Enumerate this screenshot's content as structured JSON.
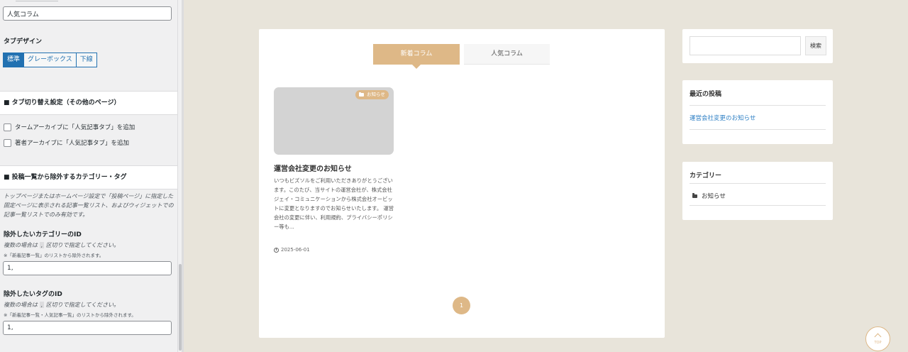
{
  "customizer": {
    "title_input_value": "人気コラム",
    "tab_design_label": "タブデザイン",
    "tab_design_options": [
      "標準",
      "グレーボックス",
      "下線"
    ],
    "tab_design_selected": "標準",
    "tab_switch_section_title": "■ タブ切り替え設定（その他のページ）",
    "checkboxes": [
      "タームアーカイブに「人気記事タブ」を追加",
      "著者アーカイブに「人気記事タブ」を追加"
    ],
    "exclude_section_title": "■ 投稿一覧から除外するカテゴリー・タグ",
    "exclude_description": "トップページまたはホームページ設定で「投稿ページ」に指定した固定ページに表示される記事一覧リスト、およびウィジェットでの記事一覧リストでのみ有効です。",
    "exclude_cat": {
      "label": "除外したいカテゴリーのID",
      "help_pre": "複数の場合は",
      "help_code": ",",
      "help_post": "区切りで指定してください。",
      "note": "※「新着記事一覧」のリストから除外されます。",
      "value": "1,"
    },
    "exclude_tag": {
      "label": "除外したいタグのID",
      "help_pre": "複数の場合は",
      "help_code": ",",
      "help_post": "区切りで指定してください。",
      "note": "※「新着記事一覧・人気記事一覧」のリストから除外されます。",
      "value": "1,"
    }
  },
  "main": {
    "tabs": [
      "新着コラム",
      "人気コラム"
    ],
    "active_tab": "新着コラム",
    "post": {
      "category": "お知らせ",
      "title": "運営会社変更のお知らせ",
      "excerpt": "いつもビズソルをご利用いただきありがとうございます。このたび、当サイトの運営会社が、株式会社ジェイ・コミュニケーションから株式会社オービットに変更となりますのでお知らせいたします。 運営会社の変更に伴い、利用規約、プライバシーポリシー等も...",
      "date": "2025-06-01"
    },
    "pagination": [
      "1"
    ]
  },
  "sidebar": {
    "search_button": "検索",
    "search_value": "",
    "recent_title": "最近の投稿",
    "recent_posts": [
      "運営会社変更のお知らせ"
    ],
    "category_title": "カテゴリー",
    "categories": [
      "お知らせ"
    ]
  },
  "back_to_top_label": "TOP",
  "colors": {
    "accent": "#deb887",
    "admin_blue": "#2271b1",
    "link": "#2f80c5",
    "page_bg": "#e8e4da"
  }
}
